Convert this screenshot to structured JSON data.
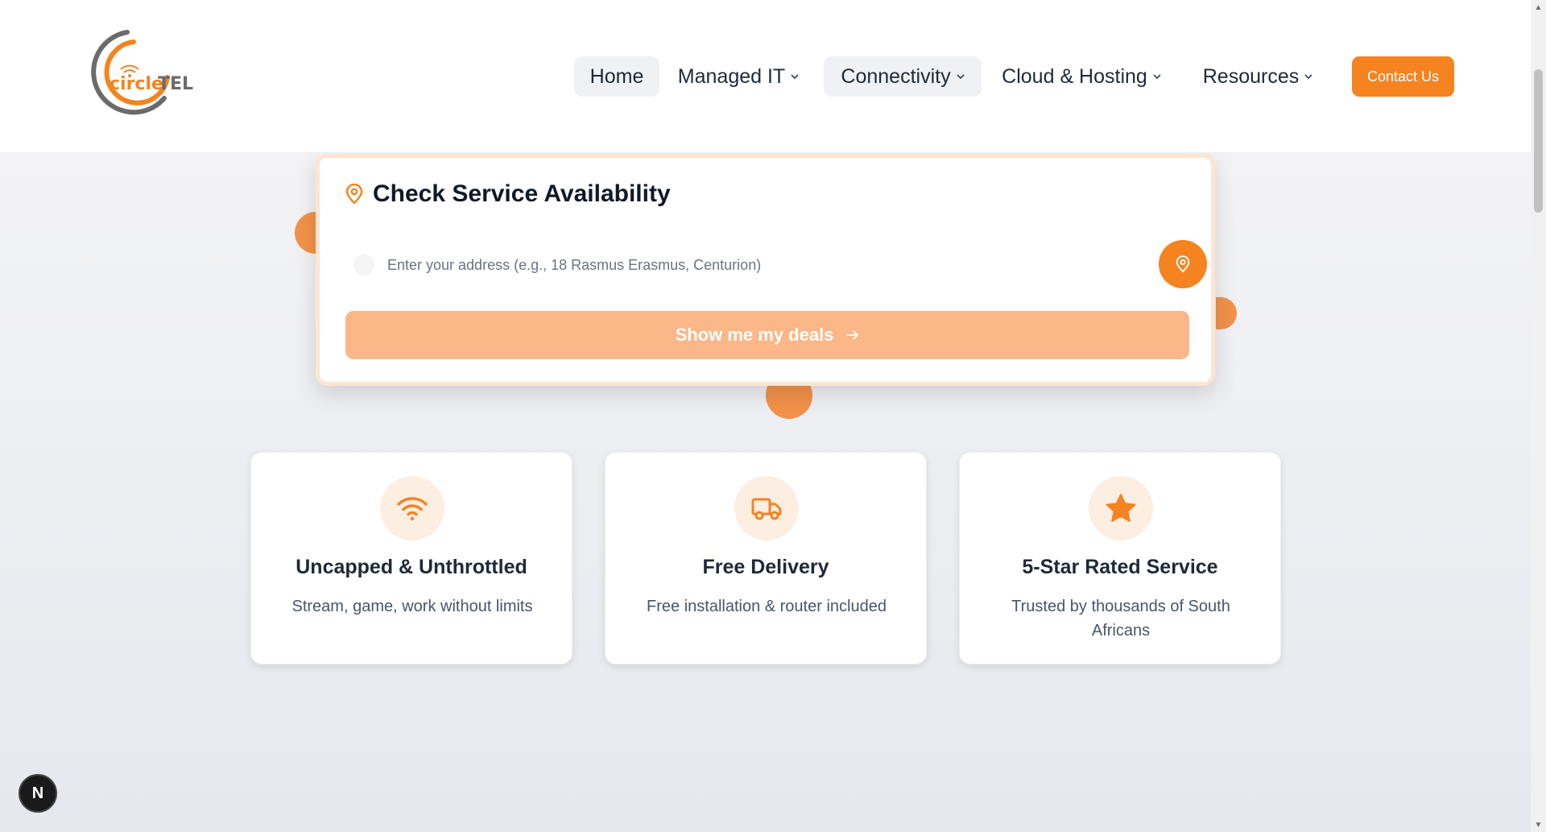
{
  "brand": {
    "logo_text_prefix": "circle",
    "logo_text_suffix": "TEL",
    "accent_color": "#f5831f"
  },
  "nav": {
    "items": [
      {
        "label": "Home",
        "has_dropdown": false,
        "active": true
      },
      {
        "label": "Managed IT",
        "has_dropdown": true,
        "active": false
      },
      {
        "label": "Connectivity",
        "has_dropdown": true,
        "active": true
      },
      {
        "label": "Cloud & Hosting",
        "has_dropdown": true,
        "active": false
      },
      {
        "label": "Resources",
        "has_dropdown": true,
        "active": false
      }
    ],
    "contact_label": "Contact Us"
  },
  "availability": {
    "title": "Check Service Availability",
    "title_icon": "map-pin-icon",
    "address_value": "",
    "address_placeholder": "Enter your address (e.g., 18 Rasmus Erasmus, Centurion)",
    "locate_icon": "map-pin-icon",
    "submit_label": "Show me my deals",
    "submit_icon": "arrow-right-icon"
  },
  "features": [
    {
      "icon": "wifi-icon",
      "title": "Uncapped & Unthrottled",
      "description": "Stream, game, work without limits"
    },
    {
      "icon": "truck-icon",
      "title": "Free Delivery",
      "description": "Free installation & router included"
    },
    {
      "icon": "star-icon",
      "title": "5-Star Rated Service",
      "description": "Trusted by thousands of South Africans"
    }
  ],
  "dev_badge": {
    "label": "N"
  }
}
